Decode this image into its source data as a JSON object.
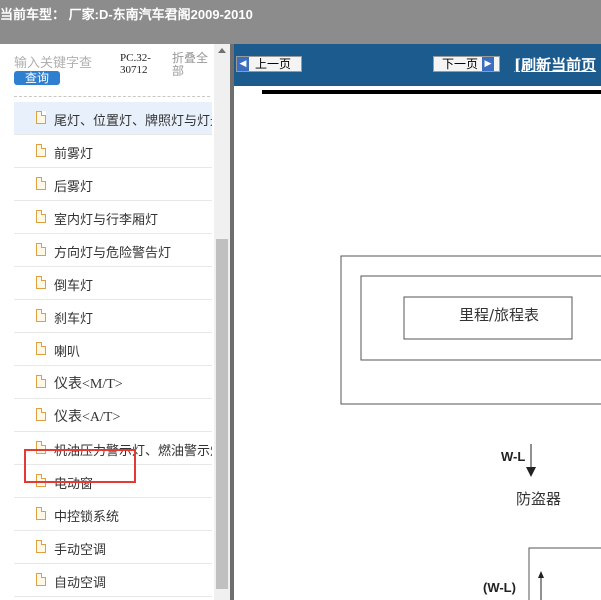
{
  "header": {
    "title": "当前车型：  厂家:D-东南汽车君阁2009-2010"
  },
  "sidebar": {
    "search_placeholder": "输入关键字查",
    "search_button": "查询",
    "pc_code": "PC.32-30712",
    "collapse_all": "折叠全部",
    "items": [
      {
        "label": "尾灯、位置灯、牌照灯与灯光"
      },
      {
        "label": "前雾灯"
      },
      {
        "label": "后雾灯"
      },
      {
        "label": "室内灯与行李厢灯"
      },
      {
        "label": "方向灯与危险警告灯"
      },
      {
        "label": "倒车灯"
      },
      {
        "label": "刹车灯"
      },
      {
        "label": "喇叭"
      },
      {
        "label": "仪表<M/T>"
      },
      {
        "label": "仪表<A/T>"
      },
      {
        "label": "机油压力警示灯、燃油警示灯"
      },
      {
        "label": "电动窗"
      },
      {
        "label": "中控锁系统"
      },
      {
        "label": "手动空调"
      },
      {
        "label": "自动空调"
      }
    ]
  },
  "toolbar": {
    "prev_label": "上一页",
    "next_label": "下一页",
    "refresh_label": "[刷新当前页"
  },
  "diagram": {
    "odometer_label": "里程/旅程表",
    "wire_label_1": "W-L",
    "antitheft_label": "防盗器",
    "wire_label_2": "(W-L)"
  },
  "colors": {
    "title_bar": "#8c8c8c",
    "nav_bar": "#1c5b8e",
    "highlight": "#e53935",
    "search_button": "#2e7fd0"
  }
}
